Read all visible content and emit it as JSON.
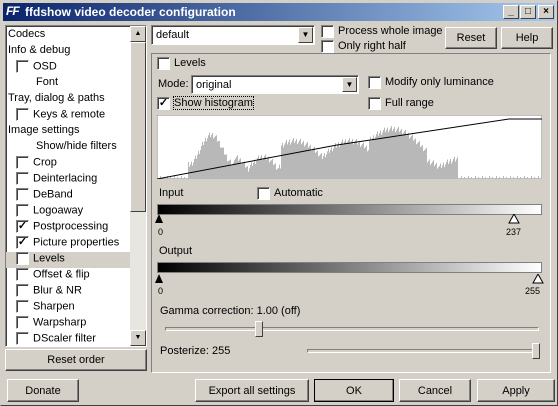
{
  "window": {
    "app_icon": "FF",
    "title": "ffdshow video decoder configuration",
    "controls": {
      "minimize": "_",
      "maximize": "□",
      "close": "×"
    }
  },
  "tree": {
    "items": [
      {
        "label": "Codecs",
        "indent": 0,
        "checkbox": false
      },
      {
        "label": "Info & debug",
        "indent": 0,
        "checkbox": false
      },
      {
        "label": "OSD",
        "indent": 1,
        "checkbox": true,
        "checked": false
      },
      {
        "label": "Font",
        "indent": 2,
        "checkbox": false
      },
      {
        "label": "Tray, dialog & paths",
        "indent": 0,
        "checkbox": false
      },
      {
        "label": "Keys & remote",
        "indent": 1,
        "checkbox": true,
        "checked": false
      },
      {
        "label": "Image settings",
        "indent": 0,
        "checkbox": false
      },
      {
        "label": "Show/hide filters",
        "indent": 2,
        "checkbox": false
      },
      {
        "label": "Crop",
        "indent": 1,
        "checkbox": true,
        "checked": false
      },
      {
        "label": "Deinterlacing",
        "indent": 1,
        "checkbox": true,
        "checked": false
      },
      {
        "label": "DeBand",
        "indent": 1,
        "checkbox": true,
        "checked": false
      },
      {
        "label": "Logoaway",
        "indent": 1,
        "checkbox": true,
        "checked": false
      },
      {
        "label": "Postprocessing",
        "indent": 1,
        "checkbox": true,
        "checked": true
      },
      {
        "label": "Picture properties",
        "indent": 1,
        "checkbox": true,
        "checked": true
      },
      {
        "label": "Levels",
        "indent": 1,
        "checkbox": true,
        "checked": false,
        "selected": true
      },
      {
        "label": "Offset & flip",
        "indent": 1,
        "checkbox": true,
        "checked": false
      },
      {
        "label": "Blur & NR",
        "indent": 1,
        "checkbox": true,
        "checked": false
      },
      {
        "label": "Sharpen",
        "indent": 1,
        "checkbox": true,
        "checked": false
      },
      {
        "label": "Warpsharp",
        "indent": 1,
        "checkbox": true,
        "checked": false
      },
      {
        "label": "DScaler filter",
        "indent": 1,
        "checkbox": true,
        "checked": false
      }
    ],
    "reset_order": "Reset order"
  },
  "top": {
    "preset": "default",
    "process_whole_image": "Process whole image",
    "only_right_half": "Only right half",
    "reset": "Reset",
    "help": "Help"
  },
  "levels": {
    "enable_label": "Levels",
    "mode_label": "Mode:",
    "mode_value": "original",
    "modify_only_luminance": "Modify only luminance",
    "show_histogram": "Show histogram",
    "full_range": "Full range",
    "input_label": "Input",
    "automatic_label": "Automatic",
    "input_low": "0",
    "input_high": "237",
    "output_label": "Output",
    "output_low": "0",
    "output_high": "255",
    "gamma_label": "Gamma correction: 1.00 (off)",
    "posterize_label": "Posterize: 255"
  },
  "bottom": {
    "donate": "Donate",
    "export": "Export all settings",
    "ok": "OK",
    "cancel": "Cancel",
    "apply": "Apply"
  }
}
